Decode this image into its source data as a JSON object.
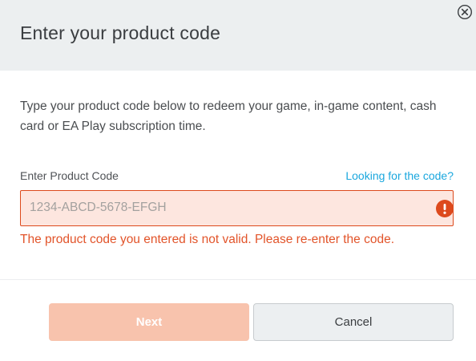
{
  "dialog": {
    "title": "Enter your product code",
    "close_icon": "close-circle-icon",
    "description": "Type your product code below to redeem your game, in-game content, cash card or EA Play subscription time.",
    "field": {
      "label": "Enter Product Code",
      "help_link": "Looking for the code?",
      "placeholder": "1234-ABCD-5678-EFGH",
      "value": "",
      "error_icon": "exclamation-circle-icon",
      "error_message": "The product code you entered is not valid. Please re-enter the code."
    },
    "buttons": {
      "next_label": "Next",
      "cancel_label": "Cancel"
    }
  },
  "colors": {
    "header_bg": "#eceff0",
    "link": "#1aa7de",
    "error": "#dd4a1d",
    "error_input_bg": "#fde6df",
    "next_disabled_bg": "#f8c3ad"
  }
}
